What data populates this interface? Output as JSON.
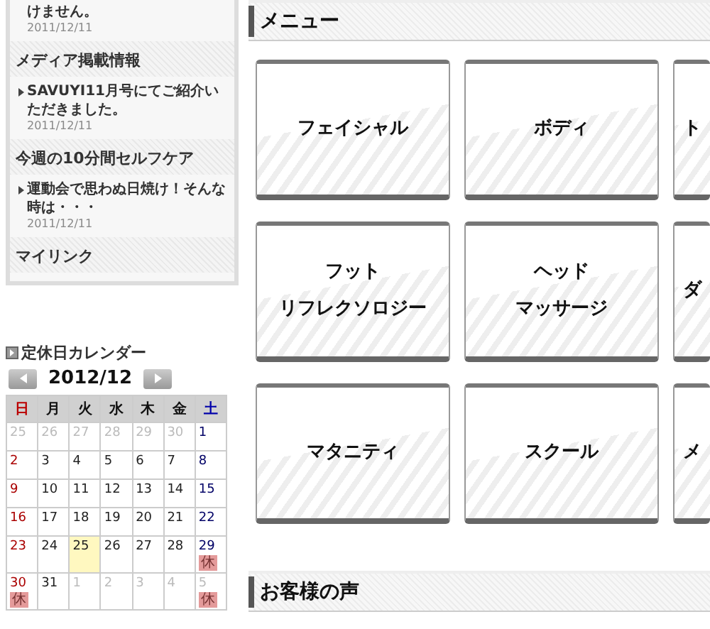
{
  "sidebar": {
    "sections": [
      {
        "items": [
          {
            "text": "けません。",
            "date": "2011/12/11",
            "bullet": false
          }
        ]
      },
      {
        "heading": "メディア掲載情報",
        "items": [
          {
            "text": "SAVUYI11月号にてご紹介いただきました。",
            "date": "2011/12/11",
            "bullet": true
          }
        ]
      },
      {
        "heading": "今週の10分間セルフケア",
        "items": [
          {
            "text": "運動会で思わぬ日焼け！そんな時は・・・",
            "date": "2011/12/11",
            "bullet": true
          }
        ]
      },
      {
        "heading": "マイリンク"
      }
    ]
  },
  "calendar": {
    "title": "定休日カレンダー",
    "month": "2012/12",
    "weekdays": [
      {
        "label": "日",
        "kind": "sun"
      },
      {
        "label": "月",
        "kind": "day"
      },
      {
        "label": "火",
        "kind": "day"
      },
      {
        "label": "水",
        "kind": "day"
      },
      {
        "label": "木",
        "kind": "day"
      },
      {
        "label": "金",
        "kind": "day"
      },
      {
        "label": "土",
        "kind": "sat"
      }
    ],
    "weeks": [
      [
        {
          "day": "25",
          "muted": true
        },
        {
          "day": "26",
          "muted": true
        },
        {
          "day": "27",
          "muted": true
        },
        {
          "day": "28",
          "muted": true
        },
        {
          "day": "29",
          "muted": true
        },
        {
          "day": "30",
          "muted": true
        },
        {
          "day": "1",
          "muted": false
        }
      ],
      [
        {
          "day": "2",
          "muted": false
        },
        {
          "day": "3",
          "muted": false
        },
        {
          "day": "4",
          "muted": false
        },
        {
          "day": "5",
          "muted": false
        },
        {
          "day": "6",
          "muted": false
        },
        {
          "day": "7",
          "muted": false
        },
        {
          "day": "8",
          "muted": false
        }
      ],
      [
        {
          "day": "9",
          "muted": false
        },
        {
          "day": "10",
          "muted": false
        },
        {
          "day": "11",
          "muted": false
        },
        {
          "day": "12",
          "muted": false
        },
        {
          "day": "13",
          "muted": false
        },
        {
          "day": "14",
          "muted": false
        },
        {
          "day": "15",
          "muted": false
        }
      ],
      [
        {
          "day": "16",
          "muted": false
        },
        {
          "day": "17",
          "muted": false
        },
        {
          "day": "18",
          "muted": false
        },
        {
          "day": "19",
          "muted": false
        },
        {
          "day": "20",
          "muted": false
        },
        {
          "day": "21",
          "muted": false
        },
        {
          "day": "22",
          "muted": false
        }
      ],
      [
        {
          "day": "23",
          "muted": false
        },
        {
          "day": "24",
          "muted": false
        },
        {
          "day": "25",
          "muted": false,
          "today": true
        },
        {
          "day": "26",
          "muted": false
        },
        {
          "day": "27",
          "muted": false
        },
        {
          "day": "28",
          "muted": false
        },
        {
          "day": "29",
          "muted": false,
          "badge": "休"
        }
      ],
      [
        {
          "day": "30",
          "muted": false,
          "badge": "休"
        },
        {
          "day": "31",
          "muted": false
        },
        {
          "day": "1",
          "muted": true
        },
        {
          "day": "2",
          "muted": true
        },
        {
          "day": "3",
          "muted": true
        },
        {
          "day": "4",
          "muted": true
        },
        {
          "day": "5",
          "muted": true,
          "badge": "休"
        }
      ]
    ]
  },
  "menu": {
    "heading": "メニュー",
    "rows": [
      [
        {
          "lines": [
            "フェイシャル"
          ]
        },
        {
          "lines": [
            "ボディ"
          ]
        },
        {
          "lines": [
            "ト"
          ]
        }
      ],
      [
        {
          "lines": [
            "フット",
            "リフレクソロジー"
          ]
        },
        {
          "lines": [
            "ヘッド",
            "マッサージ"
          ]
        },
        {
          "lines": [
            "ダ"
          ]
        }
      ],
      [
        {
          "lines": [
            "マタニティ"
          ]
        },
        {
          "lines": [
            "スクール"
          ]
        },
        {
          "lines": [
            "メ"
          ]
        }
      ]
    ]
  },
  "voices": {
    "heading": "お客様の声"
  }
}
